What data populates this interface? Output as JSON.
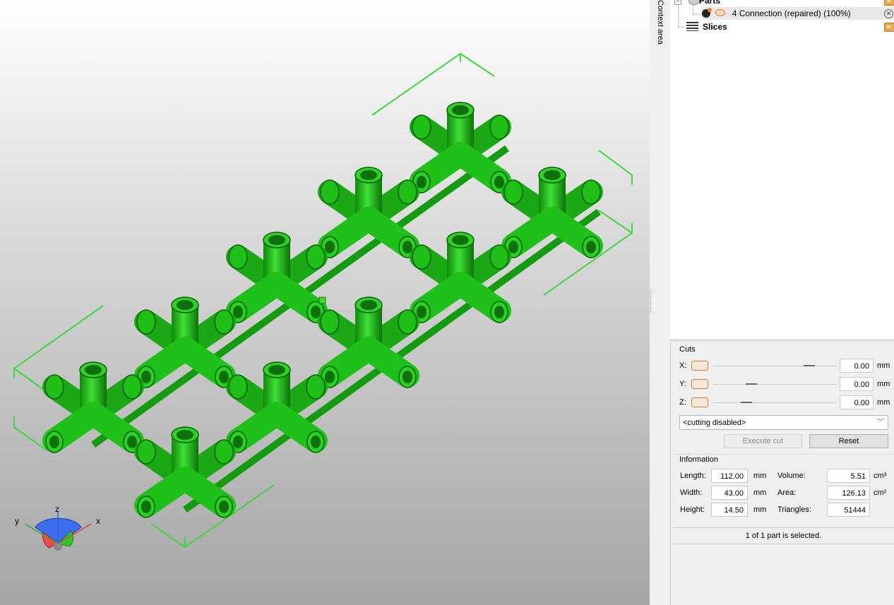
{
  "colors": {
    "part_green": "#22c41b",
    "bbox_green": "#3fd63f",
    "accent_orange": "#d77b2a",
    "axis_x_red": "#e04040",
    "axis_y_green": "#30b030",
    "axis_z_blue": "#3060e0"
  },
  "side_panel": {
    "context_label": "Context area"
  },
  "tree": {
    "parts_label": "Parts",
    "part_item_label": "4 Connection (repaired) (100%)",
    "slices_label": "Slices",
    "icons": [
      "folder-icon",
      "part-icon",
      "eye-icon",
      "remove-icon",
      "slices-icon"
    ]
  },
  "cuts": {
    "title": "Cuts",
    "axes": [
      {
        "label": "X:",
        "value": "0.00",
        "unit": "mm",
        "position": 0.73
      },
      {
        "label": "Y:",
        "value": "0.00",
        "unit": "mm",
        "position": 0.28
      },
      {
        "label": "Z:",
        "value": "0.00",
        "unit": "mm",
        "position": 0.24
      }
    ],
    "mode_selected": "<cutting disabled>",
    "execute_label": "Execute cut",
    "reset_label": "Reset"
  },
  "information": {
    "title": "Information",
    "length_label": "Length:",
    "length_value": "112.00",
    "length_unit": "mm",
    "width_label": "Width:",
    "width_value": "43.00",
    "width_unit": "mm",
    "height_label": "Height:",
    "height_value": "14.50",
    "height_unit": "mm",
    "volume_label": "Volume:",
    "volume_value": "5.51",
    "volume_unit": "cm³",
    "area_label": "Area:",
    "area_value": "126.13",
    "area_unit": "cm²",
    "triangles_label": "Triangles:",
    "triangles_value": "51444"
  },
  "status": {
    "selection_text": "1 of 1 part is selected."
  },
  "viewport": {
    "axis_labels": {
      "x": "x",
      "y": "y",
      "z": "z"
    }
  }
}
